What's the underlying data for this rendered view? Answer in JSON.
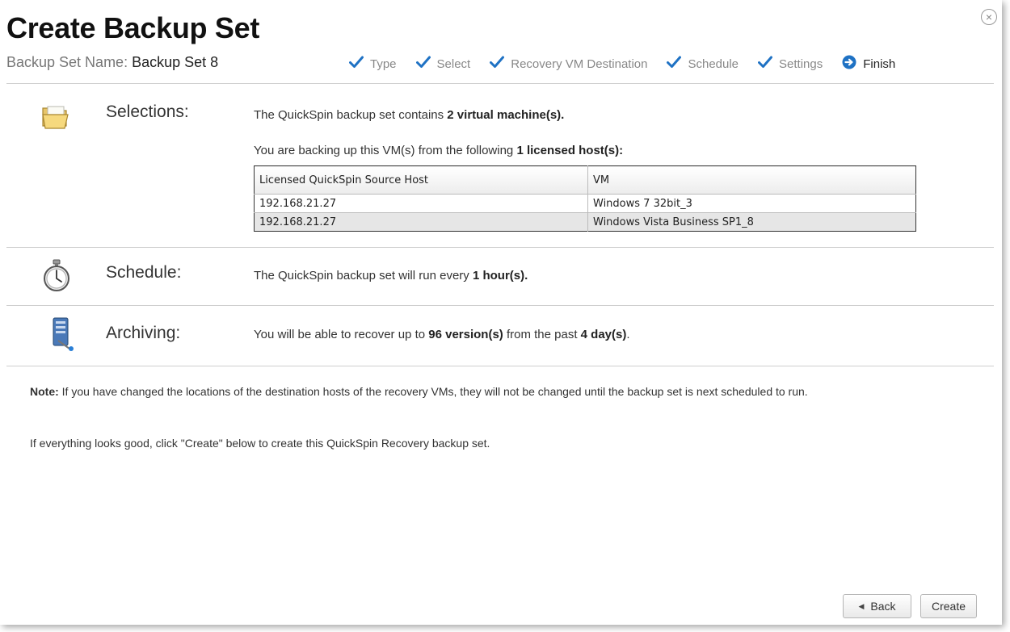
{
  "dialog": {
    "title": "Create Backup Set",
    "close_glyph": "×",
    "set_name_label": "Backup Set Name:",
    "set_name_value": "Backup Set 8"
  },
  "steps": [
    {
      "label": "Type",
      "state": "done",
      "icon": "check-icon"
    },
    {
      "label": "Select",
      "state": "done",
      "icon": "check-icon"
    },
    {
      "label": "Recovery VM Destination",
      "state": "done",
      "icon": "check-icon"
    },
    {
      "label": "Schedule",
      "state": "done",
      "icon": "check-icon"
    },
    {
      "label": "Settings",
      "state": "done",
      "icon": "check-icon"
    },
    {
      "label": "Finish",
      "state": "current",
      "icon": "arrow-circle-icon"
    }
  ],
  "selections": {
    "label": "Selections:",
    "line1_pre": "The QuickSpin backup set contains ",
    "line1_bold": "2 virtual machine(s).",
    "line2_pre": "You are backing up this VM(s) from the following ",
    "line2_bold": "1 licensed host(s):",
    "table": {
      "columns": [
        "Licensed QuickSpin Source Host",
        "VM"
      ],
      "rows": [
        [
          "192.168.21.27",
          "Windows 7 32bit_3"
        ],
        [
          "192.168.21.27",
          "Windows Vista Business SP1_8"
        ]
      ]
    }
  },
  "schedule": {
    "label": "Schedule:",
    "pre": "The QuickSpin backup set will run every ",
    "bold": "1 hour(s)."
  },
  "archiving": {
    "label": "Archiving:",
    "pre": "You will be able to recover up to ",
    "bold1": "96 version(s)",
    "mid": " from the past ",
    "bold2": "4 day(s)",
    "post": "."
  },
  "note": {
    "label": "Note:",
    "text": " If you have changed the locations of the destination hosts of the recovery VMs, they will not be changed until the backup set is next scheduled to run."
  },
  "hint": "If everything looks good, click \"Create\" below to create this QuickSpin Recovery backup set.",
  "buttons": {
    "back": "Back",
    "back_glyph": "◀",
    "create": "Create"
  },
  "colors": {
    "accent_check": "#1f72c4",
    "divider": "#cfcfcf",
    "alt_row": "#e6e6e6"
  }
}
